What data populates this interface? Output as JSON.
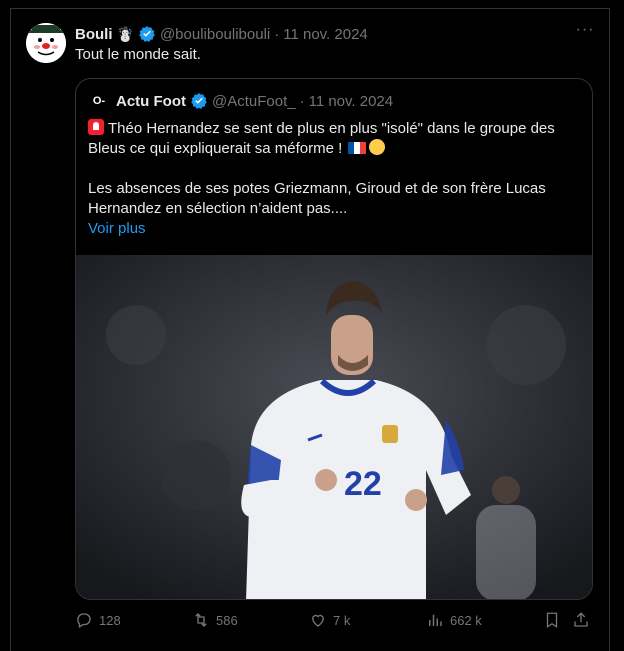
{
  "tweet": {
    "author_name": "Bouli",
    "author_emoji": "☃️",
    "handle": "@bouliboulibouli",
    "separator": "·",
    "date": "11 nov. 2024",
    "more_icon": "more-icon",
    "text": "Tout le monde sait."
  },
  "quote": {
    "avatar_label": "O‑",
    "author_name": "Actu Foot",
    "handle": "@ActuFoot_",
    "separator": "·",
    "date": "11 nov. 2024",
    "line1": "Théo Hernandez se sent de plus en plus \"isolé\" dans le groupe des Bleus ce qui expliquerait sa méforme !",
    "line2": "Les absences de ses potes Griezmann, Giroud et de son frère Lucas Hernandez en sélection n’aident pas....",
    "see_more": "Voir plus",
    "media_alt": "football player in white France jersey number 22",
    "jersey_number": "22"
  },
  "actions": {
    "reply_count": "128",
    "retweet_count": "586",
    "like_count": "7 k",
    "views_count": "662 k"
  },
  "colors": {
    "background": "#000000",
    "border": "#2f3336",
    "text": "#e7e9ea",
    "muted": "#71767b",
    "link": "#1d9bf0",
    "verified": "#1d9bf0"
  }
}
